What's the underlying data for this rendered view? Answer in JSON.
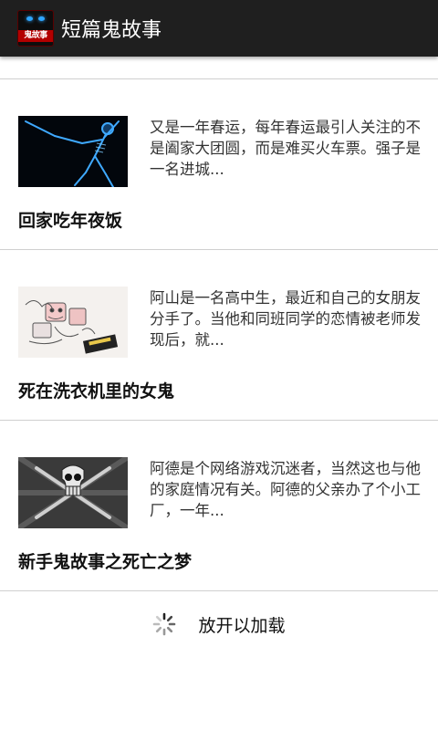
{
  "app": {
    "title": "短篇鬼故事",
    "icon_label": "鬼故事",
    "icon_name": "ghost-app-icon"
  },
  "stories": [
    {
      "title": "回家吃年夜饭",
      "summary": "又是一年春运，每年春运最引人关注的不是阖家大团圆，而是难买火车票。强子是一名进城...",
      "thumbnail": "xray-skeleton-image"
    },
    {
      "title": "死在洗衣机里的女鬼",
      "summary": "阿山是一名高中生，最近和自己的女朋友分手了。当他和同班同学的恋情被老师发现后，就...",
      "thumbnail": "doodle-monsters-image"
    },
    {
      "title": "新手鬼故事之死亡之梦",
      "summary": "阿德是个网络游戏沉迷者，当然这也与他的家庭情况有关。阿德的父亲办了个小工厂，一年...",
      "thumbnail": "skull-weapons-image"
    }
  ],
  "loader": {
    "text": "放开以加载",
    "icon_name": "loading-spinner-icon"
  },
  "colors": {
    "actionbar": "#1f1f1f",
    "divider": "#cfcfcf",
    "background": "#ffffff"
  }
}
